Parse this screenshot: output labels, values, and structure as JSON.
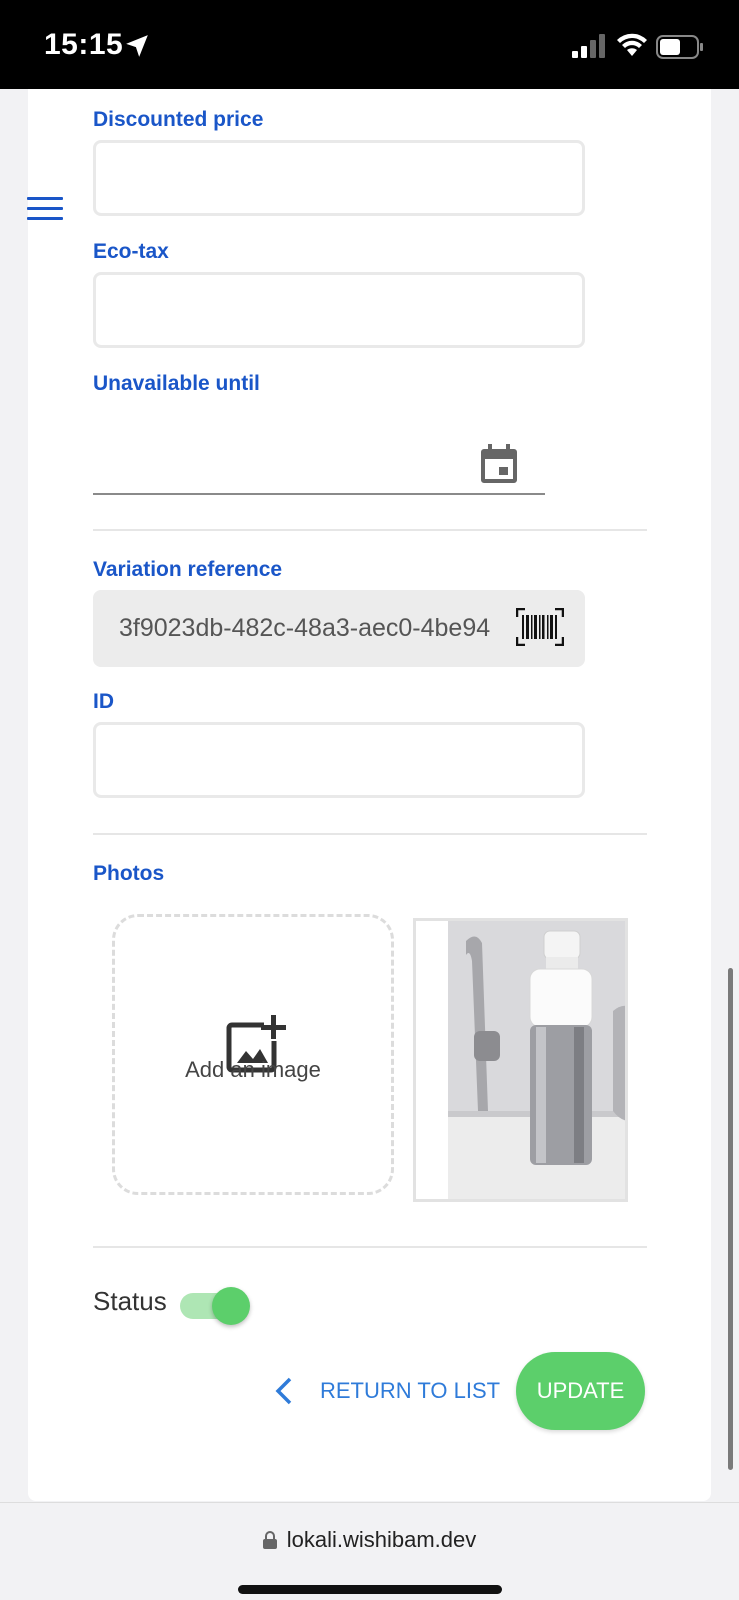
{
  "status_bar": {
    "time": "15:15"
  },
  "form": {
    "discounted_price": {
      "label": "Discounted price",
      "value": ""
    },
    "eco_tax": {
      "label": "Eco-tax",
      "value": ""
    },
    "unavailable_until": {
      "label": "Unavailable until",
      "value": ""
    },
    "variation_reference": {
      "label": "Variation reference",
      "value": "3f9023db-482c-48a3-aec0-4be94"
    },
    "id": {
      "label": "ID",
      "value": ""
    },
    "photos": {
      "label": "Photos",
      "add_image": "Add an image"
    },
    "status": {
      "label": "Status",
      "enabled": true
    }
  },
  "actions": {
    "return_label": "RETURN TO LIST",
    "update_label": "UPDATE"
  },
  "browser": {
    "url": "lokali.wishibam.dev"
  },
  "colors": {
    "accent_blue": "#1a56c8",
    "link_blue": "#2f7bd9",
    "green": "#5ccf6b"
  }
}
